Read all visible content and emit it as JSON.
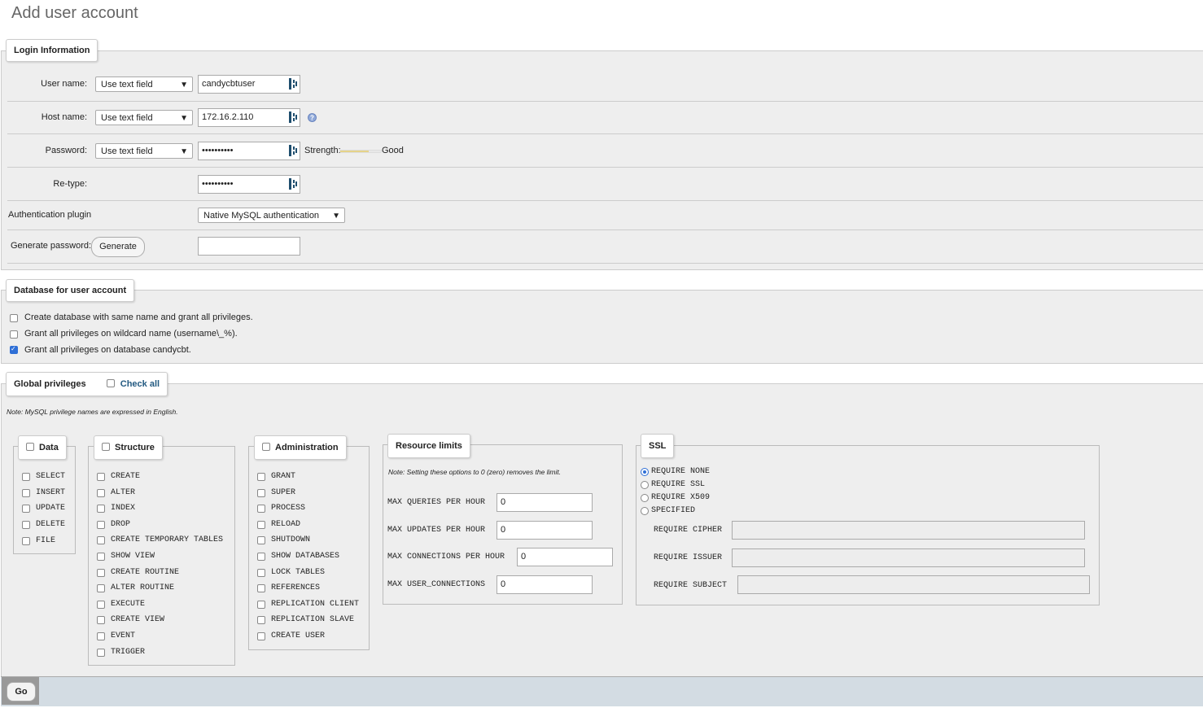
{
  "page": {
    "title": "Add user account"
  },
  "login": {
    "legend": "Login Information",
    "user_label": "User name:",
    "user_mode": "Use text field",
    "user_value": "candycbtuser",
    "host_label": "Host name:",
    "host_mode": "Use text field",
    "host_value": "172.16.2.110",
    "password_label": "Password:",
    "password_mode": "Use text field",
    "password_value": "••••••••••",
    "strength_label": "Strength:",
    "strength_value": "Good",
    "retype_label": "Re-type:",
    "retype_value": "••••••••••",
    "auth_label": "Authentication plugin",
    "auth_value": "Native MySQL authentication",
    "generate_label": "Generate password:",
    "generate_button": "Generate",
    "generated_value": ""
  },
  "database": {
    "legend": "Database for user account",
    "options": [
      {
        "label": "Create database with same name and grant all privileges.",
        "checked": false
      },
      {
        "label": "Grant all privileges on wildcard name (username\\_%).",
        "checked": false
      },
      {
        "label": "Grant all privileges on database candycbt.",
        "checked": true
      }
    ]
  },
  "global": {
    "legend": "Global privileges",
    "check_all": "Check all",
    "note": "Note: MySQL privilege names are expressed in English."
  },
  "data_group": {
    "legend": "Data",
    "items": [
      "SELECT",
      "INSERT",
      "UPDATE",
      "DELETE",
      "FILE"
    ]
  },
  "structure_group": {
    "legend": "Structure",
    "items": [
      "CREATE",
      "ALTER",
      "INDEX",
      "DROP",
      "CREATE TEMPORARY TABLES",
      "SHOW VIEW",
      "CREATE ROUTINE",
      "ALTER ROUTINE",
      "EXECUTE",
      "CREATE VIEW",
      "EVENT",
      "TRIGGER"
    ]
  },
  "admin_group": {
    "legend": "Administration",
    "items": [
      "GRANT",
      "SUPER",
      "PROCESS",
      "RELOAD",
      "SHUTDOWN",
      "SHOW DATABASES",
      "LOCK TABLES",
      "REFERENCES",
      "REPLICATION CLIENT",
      "REPLICATION SLAVE",
      "CREATE USER"
    ]
  },
  "resource": {
    "legend": "Resource limits",
    "note": "Note: Setting these options to 0 (zero) removes the limit.",
    "rows": [
      {
        "label": "MAX QUERIES PER HOUR",
        "value": "0"
      },
      {
        "label": "MAX UPDATES PER HOUR",
        "value": "0"
      },
      {
        "label": "MAX CONNECTIONS PER HOUR",
        "value": "0"
      },
      {
        "label": "MAX USER_CONNECTIONS",
        "value": "0"
      }
    ]
  },
  "ssl": {
    "legend": "SSL",
    "options": [
      {
        "label": "REQUIRE NONE",
        "checked": true
      },
      {
        "label": "REQUIRE SSL",
        "checked": false
      },
      {
        "label": "REQUIRE X509",
        "checked": false
      },
      {
        "label": "SPECIFIED",
        "checked": false
      }
    ],
    "cipher_label": "REQUIRE CIPHER",
    "issuer_label": "REQUIRE ISSUER",
    "subject_label": "REQUIRE SUBJECT"
  },
  "footer": {
    "go_button": "Go"
  }
}
